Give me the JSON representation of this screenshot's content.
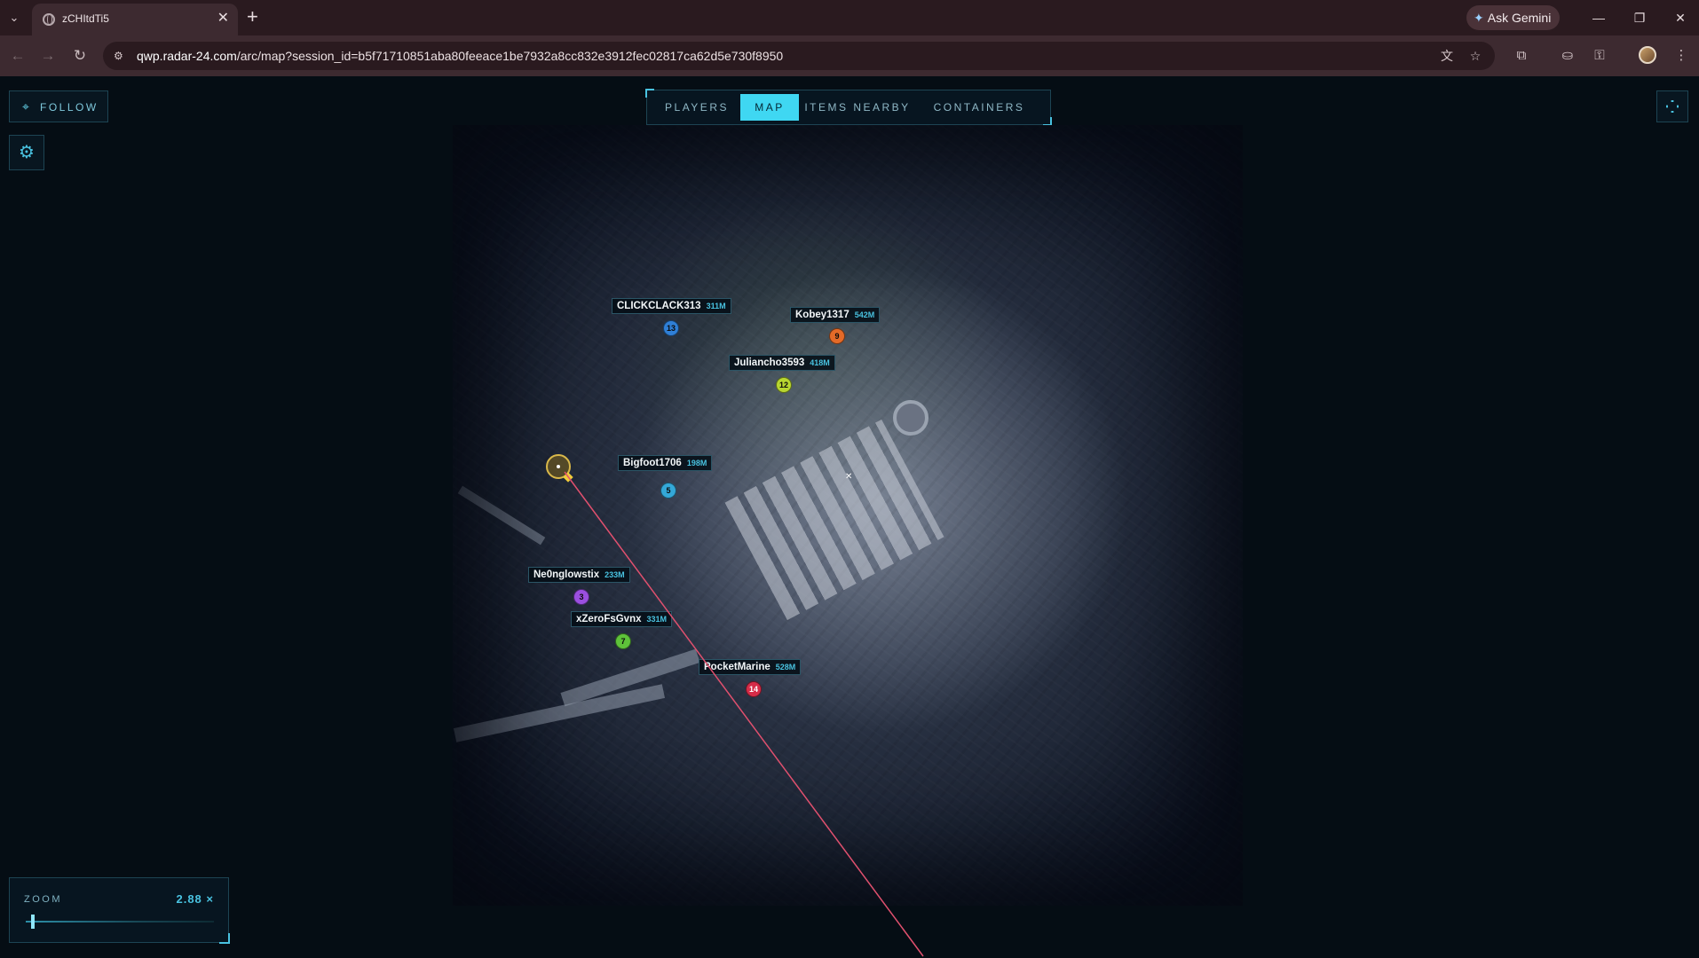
{
  "browser": {
    "tab_title": "zCHItdTi5",
    "tab_close": "✕",
    "new_tab": "+",
    "ask_gemini": "Ask Gemini",
    "url_host": "qwp.radar-24.com",
    "url_path": "/arc/map?session_id=b5f71710851aba80feeace1be7932a8cc832e3912fec02817ca62d5e730f8950"
  },
  "app": {
    "follow_label": "FOLLOW",
    "tabs": [
      {
        "label": "PLAYERS",
        "active": false
      },
      {
        "label": "MAP",
        "active": true
      },
      {
        "label": "ITEMS NEARBY",
        "active": false
      },
      {
        "label": "CONTAINERS",
        "active": false
      }
    ],
    "zoom": {
      "label": "ZOOM",
      "value_text": "2.88 ×",
      "value": 2.88,
      "fraction": 0.03
    }
  },
  "players": [
    {
      "name": "CLICKCLACK313",
      "distance": "311M",
      "id": "13",
      "color": "#2f7fd6"
    },
    {
      "name": "Kobey1317",
      "distance": "542M",
      "id": "9",
      "color": "#e46a28"
    },
    {
      "name": "Juliancho3593",
      "distance": "418M",
      "id": "12",
      "color": "#b8d630"
    },
    {
      "name": "Bigfoot1706",
      "distance": "198M",
      "id": "5",
      "color": "#34a8d8"
    },
    {
      "name": "Ne0nglowstix",
      "distance": "233M",
      "id": "3",
      "color": "#9b4fe0"
    },
    {
      "name": "xZeroFsGvnx",
      "distance": "331M",
      "id": "7",
      "color": "#5ec23a"
    },
    {
      "name": "PocketMarine",
      "distance": "528M",
      "id": "14",
      "color": "#d62c48"
    }
  ],
  "colors": {
    "accent": "#3fd7f2",
    "self": "#d9b84a",
    "aim_line": "#e0506e"
  }
}
